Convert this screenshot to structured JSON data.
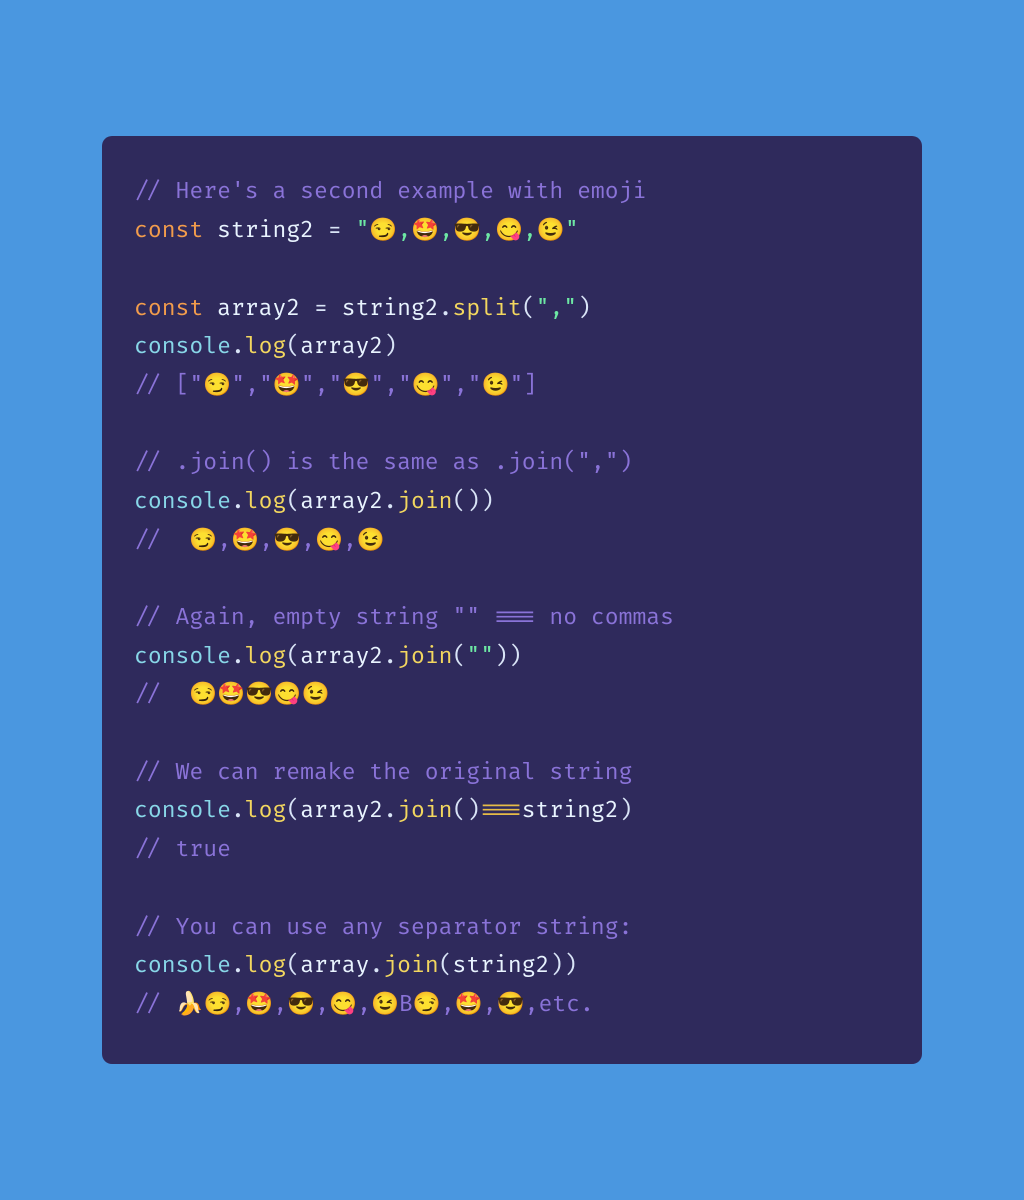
{
  "code": {
    "l1_comment": "// Here's a second example with emoji",
    "l2_const": "const",
    "l2_var": "string2",
    "l2_eq": " = ",
    "l2_str": "\"😏,🤩,😎,😋,😉\"",
    "l4_const": "const",
    "l4_var": "array2",
    "l4_eq": " = ",
    "l4_src": "string2",
    "l4_dot": ".",
    "l4_fn": "split",
    "l4_open": "(",
    "l4_arg": "\",\"",
    "l4_close": ")",
    "l5_console": "console",
    "l5_dot": ".",
    "l5_log": "log",
    "l5_open": "(",
    "l5_arg": "array2",
    "l5_close": ")",
    "l6_comment": "// [\"😏\",\"🤩\",\"😎\",\"😋\",\"😉\"]",
    "l8_comment": "// .join() is the same as .join(\",\")",
    "l9_console": "console",
    "l9_dot": ".",
    "l9_log": "log",
    "l9_open": "(",
    "l9_arg": "array2",
    "l9_dot2": ".",
    "l9_join": "join",
    "l9_openb": "(",
    "l9_closeb": ")",
    "l9_close": ")",
    "l10_comment": "//  😏,🤩,😎,😋,😉",
    "l12_comment": "// Again, empty string \"\" === no commas",
    "l13_console": "console",
    "l13_dot": ".",
    "l13_log": "log",
    "l13_open": "(",
    "l13_arg": "array2",
    "l13_dot2": ".",
    "l13_join": "join",
    "l13_openb": "(",
    "l13_jarg": "\"\"",
    "l13_closeb": ")",
    "l13_close": ")",
    "l14_comment": "//  😏🤩😎😋😉",
    "l16_comment": "// We can remake the original string",
    "l17_console": "console",
    "l17_dot": ".",
    "l17_log": "log",
    "l17_open": "(",
    "l17_arg": "array2",
    "l17_dot2": ".",
    "l17_join": "join",
    "l17_openb": "(",
    "l17_closeb": ")",
    "l17_eqeq": "===",
    "l17_rhs": "string2",
    "l17_close": ")",
    "l18_comment": "// true",
    "l20_comment": "// You can use any separator string:",
    "l21_console": "console",
    "l21_dot": ".",
    "l21_log": "log",
    "l21_open": "(",
    "l21_arg": "array",
    "l21_dot2": ".",
    "l21_join": "join",
    "l21_openb": "(",
    "l21_jarg": "string2",
    "l21_closeb": ")",
    "l21_close": ")",
    "l22_comment": "// 🍌😏,🤩,😎,😋,😉B😏,🤩,😎,etc."
  }
}
